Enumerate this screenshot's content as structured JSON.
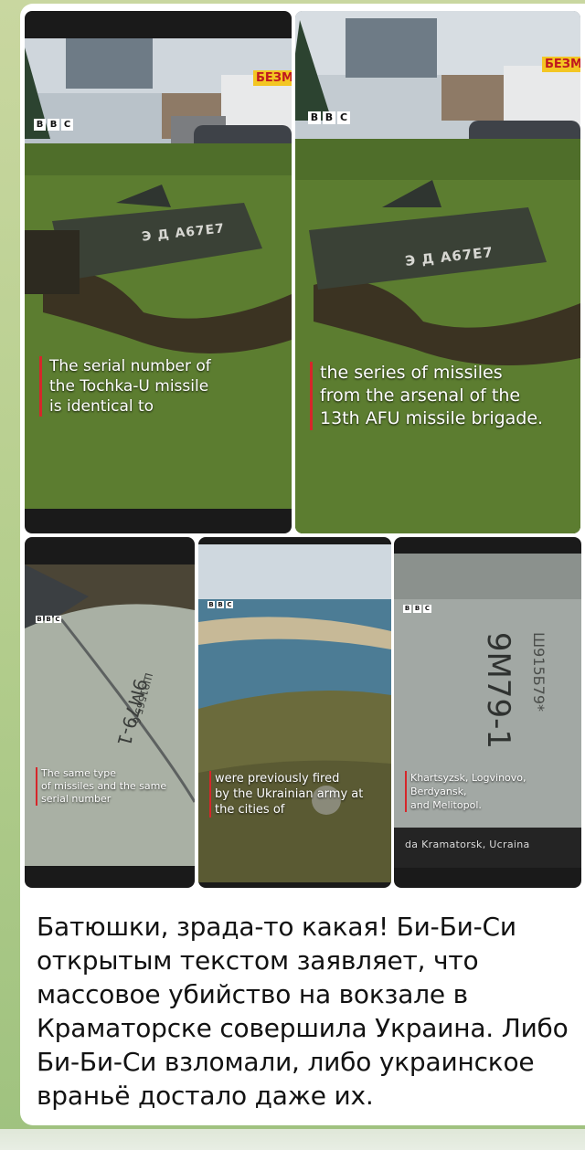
{
  "brand": {
    "channel_logo": [
      "B",
      "B",
      "C"
    ]
  },
  "colors": {
    "accent_bar": "#d6262a",
    "chat_bg": "#b7cf8f"
  },
  "top_left": {
    "sign": "БЕЗМ",
    "caption": "The serial number of\nthe Tochka-U missile\nis identical to",
    "marking": "Э Д А67Е7"
  },
  "top_right": {
    "sign": "БЕЗМ",
    "caption": "the series of missiles\nfrom the arsenal of the\n13th AFU missile brigade.",
    "marking": "Э Д А67Е7"
  },
  "bottom_1": {
    "caption": "The same type\nof missiles and the same\nserial number",
    "marking": "9М79-1",
    "marking_sub": "Ш91565 б"
  },
  "bottom_2": {
    "caption": "were previously fired\nby the Ukrainian army at\nthe cities of"
  },
  "bottom_3": {
    "caption": "Khartsyzsk, Logvinovo,\nBerdyansk,\nand Melitopol.",
    "marking": "9М79-1",
    "marking_sub": "Ш915Б79*",
    "footer": "da Kramatorsk, Ucraina"
  },
  "post_text": "Батюшки, зрада-то какая! Би-Би-Си открытым текстом заявляет, что массовое убийство на вокзале в Краматорске совершила Украина. Либо Би-Би-Си взломали, либо украинское враньё достало даже их."
}
